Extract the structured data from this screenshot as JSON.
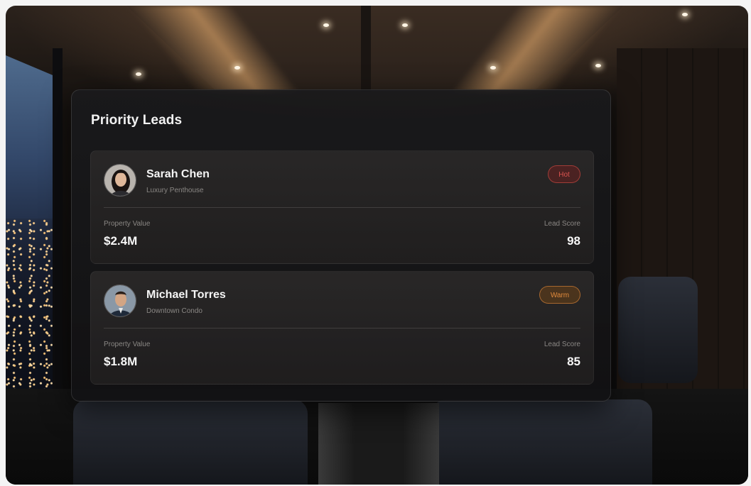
{
  "panel": {
    "title": "Priority Leads"
  },
  "leads": [
    {
      "name": "Sarah Chen",
      "property_type": "Luxury Penthouse",
      "status": "Hot",
      "status_color": "#d9534f",
      "value_label": "Property Value",
      "value": "$2.4M",
      "score_label": "Lead Score",
      "score": "98",
      "avatar_icon": "person-avatar-female"
    },
    {
      "name": "Michael Torres",
      "property_type": "Downtown Condo",
      "status": "Warm",
      "status_color": "#e08a3c",
      "value_label": "Property Value",
      "value": "$1.8M",
      "score_label": "Lead Score",
      "score": "85",
      "avatar_icon": "person-avatar-male"
    }
  ]
}
